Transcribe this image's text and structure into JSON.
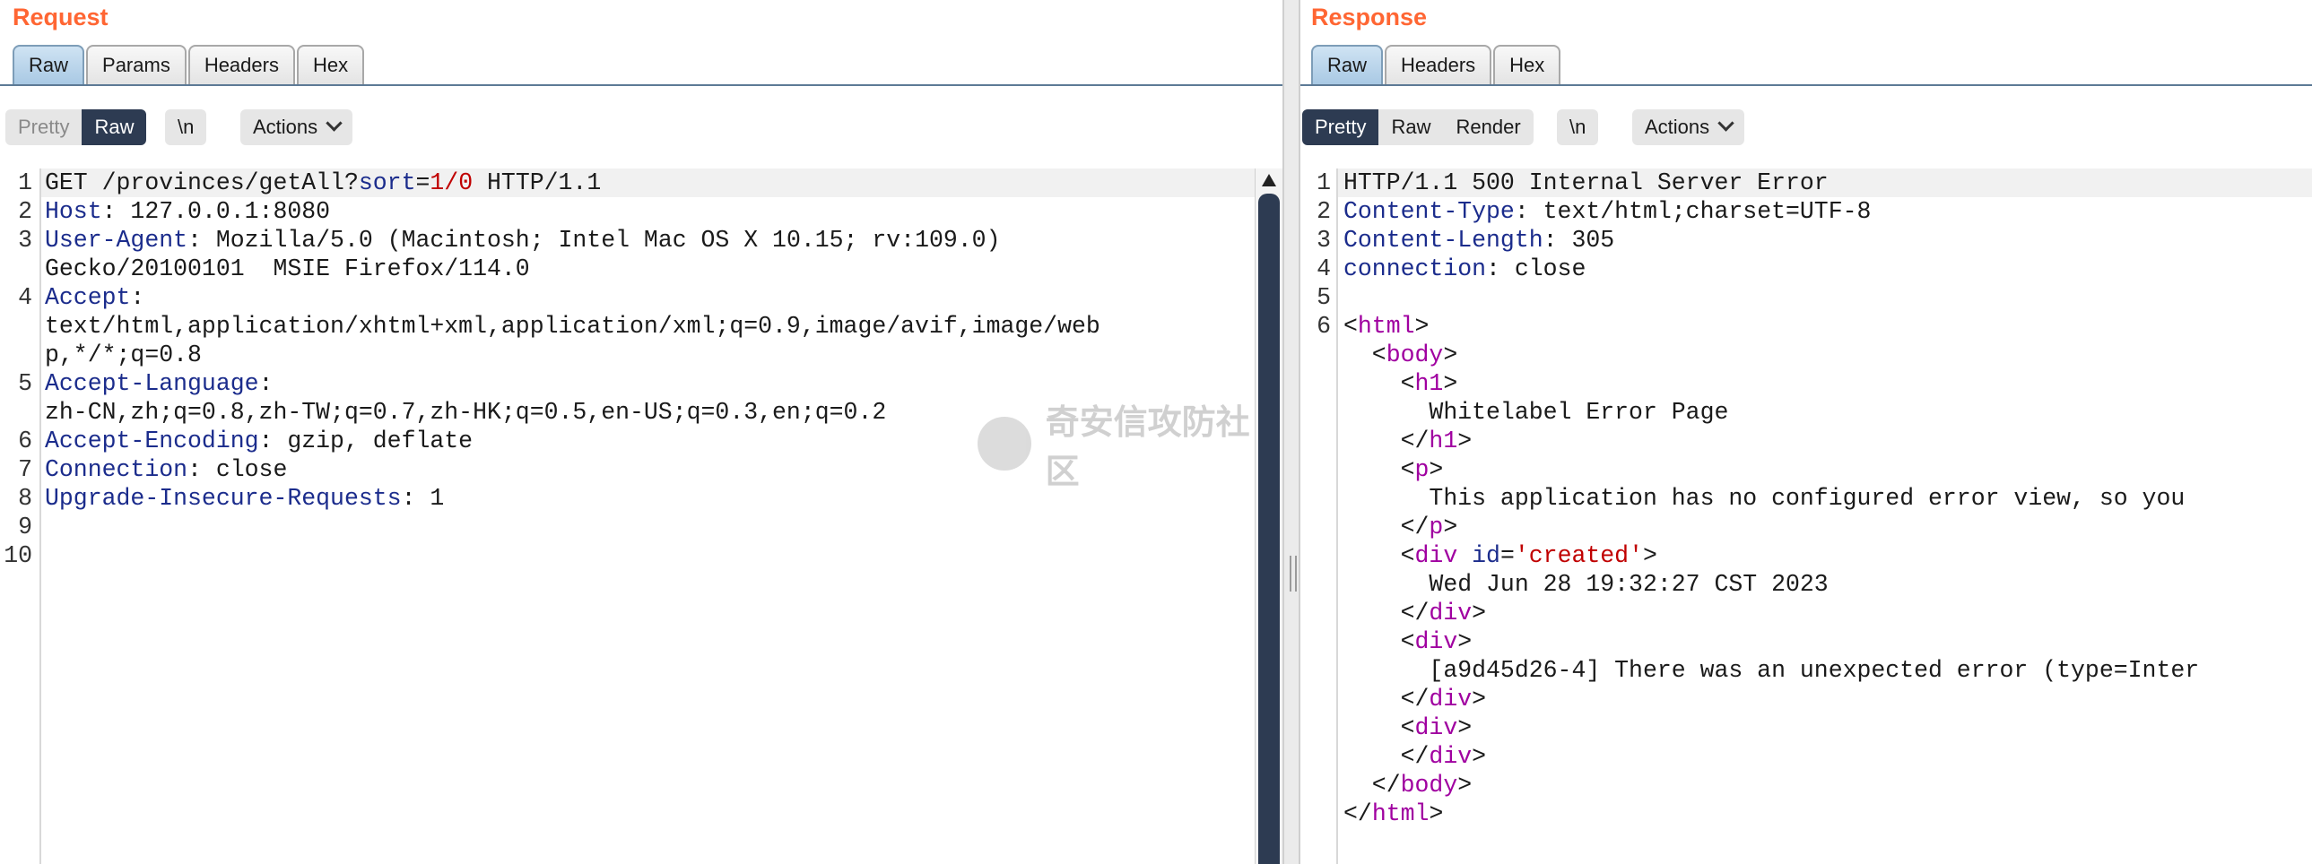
{
  "request": {
    "title": "Request",
    "tabs": [
      "Raw",
      "Params",
      "Headers",
      "Hex"
    ],
    "view_toggle": [
      "Pretty",
      "Raw"
    ],
    "newline_button": "\\n",
    "actions_button": "Actions",
    "line_numbers": [
      "1",
      "2",
      "3",
      "",
      "4",
      "",
      "",
      "5",
      "",
      "6",
      "7",
      "8",
      "9",
      "10"
    ],
    "lines": [
      [
        [
          "GET /provinces/getAll?",
          ""
        ],
        [
          "sort",
          "k"
        ],
        [
          "=",
          ""
        ],
        [
          "1/0",
          "sv"
        ],
        [
          " HTTP/1.1",
          ""
        ]
      ],
      [
        [
          "Host",
          "k"
        ],
        [
          ": 127.0.0.1:8080",
          ""
        ]
      ],
      [
        [
          "User-Agent",
          "k"
        ],
        [
          ": Mozilla/5.0 (Macintosh; Intel Mac OS X 10.15; rv:109.0)",
          ""
        ]
      ],
      [
        [
          "Gecko/20100101  MSIE Firefox/114.0",
          ""
        ]
      ],
      [
        [
          "Accept",
          "k"
        ],
        [
          ":",
          ""
        ]
      ],
      [
        [
          "text/html,application/xhtml+xml,application/xml;q=0.9,image/avif,image/web",
          ""
        ]
      ],
      [
        [
          "p,*/*;q=0.8",
          ""
        ]
      ],
      [
        [
          "Accept-Language",
          "k"
        ],
        [
          ":",
          ""
        ]
      ],
      [
        [
          "zh-CN,zh;q=0.8,zh-TW;q=0.7,zh-HK;q=0.5,en-US;q=0.3,en;q=0.2",
          ""
        ]
      ],
      [
        [
          "Accept-Encoding",
          "k"
        ],
        [
          ": gzip, deflate",
          ""
        ]
      ],
      [
        [
          "Connection",
          "k"
        ],
        [
          ": close",
          ""
        ]
      ],
      [
        [
          "Upgrade-Insecure-Requests",
          "k"
        ],
        [
          ": 1",
          ""
        ]
      ],
      [
        [
          "",
          ""
        ]
      ],
      [
        [
          "",
          ""
        ]
      ]
    ]
  },
  "response": {
    "title": "Response",
    "tabs": [
      "Raw",
      "Headers",
      "Hex"
    ],
    "view_toggle": [
      "Pretty",
      "Raw",
      "Render"
    ],
    "newline_button": "\\n",
    "actions_button": "Actions",
    "line_numbers": [
      "1",
      "2",
      "3",
      "4",
      "5",
      "6",
      "",
      "",
      "",
      "",
      "",
      "",
      "",
      "",
      "",
      "",
      "",
      "",
      "",
      "",
      "",
      "",
      ""
    ],
    "lines": [
      [
        [
          "HTTP/1.1 500 Internal Server Error",
          ""
        ]
      ],
      [
        [
          "Content-Type",
          "k"
        ],
        [
          ": text/html;charset=UTF-8",
          ""
        ]
      ],
      [
        [
          "Content-Length",
          "k"
        ],
        [
          ": 305",
          ""
        ]
      ],
      [
        [
          "connection",
          "k"
        ],
        [
          ": close",
          ""
        ]
      ],
      [
        [
          "",
          ""
        ]
      ],
      [
        [
          "<",
          ""
        ],
        [
          "html",
          "tg"
        ],
        [
          ">",
          ""
        ]
      ],
      [
        [
          "  <",
          ""
        ],
        [
          "body",
          "tg"
        ],
        [
          ">",
          ""
        ]
      ],
      [
        [
          "    <",
          ""
        ],
        [
          "h1",
          "tg"
        ],
        [
          ">",
          ""
        ]
      ],
      [
        [
          "      Whitelabel Error Page",
          ""
        ]
      ],
      [
        [
          "    </",
          ""
        ],
        [
          "h1",
          "tg"
        ],
        [
          ">",
          ""
        ]
      ],
      [
        [
          "    <",
          ""
        ],
        [
          "p",
          "tg"
        ],
        [
          ">",
          ""
        ]
      ],
      [
        [
          "      This application has no configured error view, so you",
          ""
        ]
      ],
      [
        [
          "    </",
          ""
        ],
        [
          "p",
          "tg"
        ],
        [
          ">",
          ""
        ]
      ],
      [
        [
          "    <",
          ""
        ],
        [
          "div",
          "tg"
        ],
        [
          " ",
          ""
        ],
        [
          "id",
          "k"
        ],
        [
          "=",
          ""
        ],
        [
          "'created'",
          "sv"
        ],
        [
          ">",
          ""
        ]
      ],
      [
        [
          "      Wed Jun 28 19:32:27 CST 2023",
          ""
        ]
      ],
      [
        [
          "    </",
          ""
        ],
        [
          "div",
          "tg"
        ],
        [
          ">",
          ""
        ]
      ],
      [
        [
          "    <",
          ""
        ],
        [
          "div",
          "tg"
        ],
        [
          ">",
          ""
        ]
      ],
      [
        [
          "      [a9d45d26-4] There was an unexpected error (type=Inter",
          ""
        ]
      ],
      [
        [
          "    </",
          ""
        ],
        [
          "div",
          "tg"
        ],
        [
          ">",
          ""
        ]
      ],
      [
        [
          "    <",
          ""
        ],
        [
          "div",
          "tg"
        ],
        [
          ">",
          ""
        ]
      ],
      [
        [
          "    </",
          ""
        ],
        [
          "div",
          "tg"
        ],
        [
          ">",
          ""
        ]
      ],
      [
        [
          "  </",
          ""
        ],
        [
          "body",
          "tg"
        ],
        [
          ">",
          ""
        ]
      ],
      [
        [
          "</",
          ""
        ],
        [
          "html",
          "tg"
        ],
        [
          ">",
          ""
        ]
      ]
    ]
  },
  "watermark": "奇安信攻防社区",
  "colors": {
    "accent": "#ff6633",
    "keyword": "#1b2c8c",
    "tag": "#a000a0",
    "string": "#c00000",
    "active_toggle": "#2d3b52"
  }
}
